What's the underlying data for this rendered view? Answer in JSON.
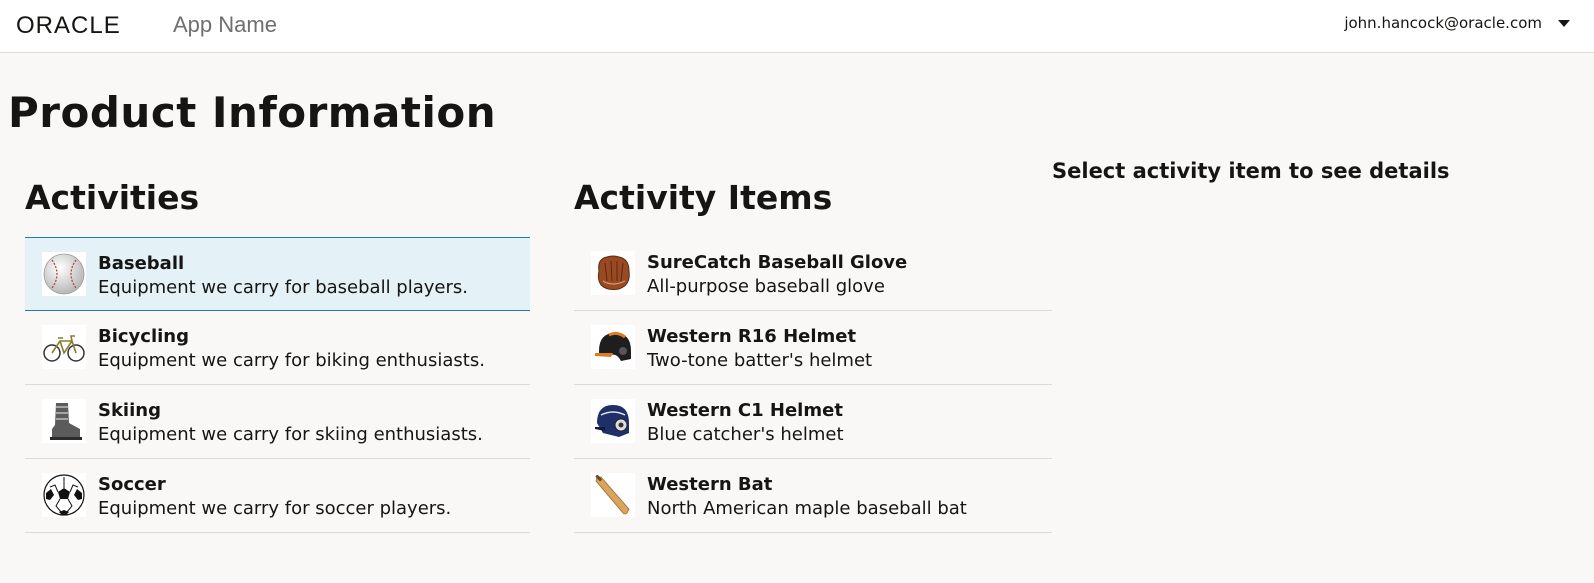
{
  "header": {
    "logo_text": "ORACLE",
    "app_name": "App Name",
    "user_email": "john.hancock@oracle.com"
  },
  "page": {
    "title": "Product Information"
  },
  "activities": {
    "title": "Activities",
    "selected_index": 0,
    "items": [
      {
        "name": "Baseball",
        "description": "Equipment we carry for baseball players.",
        "icon": "baseball-icon"
      },
      {
        "name": "Bicycling",
        "description": "Equipment we carry for biking enthusiasts.",
        "icon": "bicycle-icon"
      },
      {
        "name": "Skiing",
        "description": "Equipment we carry for skiing enthusiasts.",
        "icon": "ski-boot-icon"
      },
      {
        "name": "Soccer",
        "description": "Equipment we carry for soccer players.",
        "icon": "soccer-ball-icon"
      }
    ]
  },
  "activity_items": {
    "title": "Activity Items",
    "items": [
      {
        "name": "SureCatch Baseball Glove",
        "description": "All-purpose baseball glove",
        "icon": "baseball-glove-icon"
      },
      {
        "name": "Western R16 Helmet",
        "description": "Two-tone batter's helmet",
        "icon": "batting-helmet-icon"
      },
      {
        "name": "Western C1 Helmet",
        "description": "Blue catcher's helmet",
        "icon": "catcher-helmet-icon"
      },
      {
        "name": "Western Bat",
        "description": "North American maple baseball bat",
        "icon": "baseball-bat-icon"
      }
    ]
  },
  "details": {
    "prompt": "Select activity item to see details"
  }
}
